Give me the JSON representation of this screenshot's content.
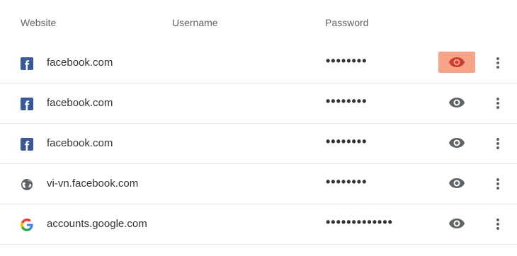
{
  "columns": {
    "website": "Website",
    "username": "Username",
    "password": "Password"
  },
  "rows": [
    {
      "site": "facebook.com",
      "username": "",
      "password_mask": "••••••••",
      "site_icon": "facebook-icon",
      "eye_highlighted": true
    },
    {
      "site": "facebook.com",
      "username": "",
      "password_mask": "••••••••",
      "site_icon": "facebook-icon",
      "eye_highlighted": false
    },
    {
      "site": "facebook.com",
      "username": "",
      "password_mask": "••••••••",
      "site_icon": "facebook-icon",
      "eye_highlighted": false
    },
    {
      "site": "vi-vn.facebook.com",
      "username": "",
      "password_mask": "••••••••",
      "site_icon": "globe-icon",
      "eye_highlighted": false
    },
    {
      "site": "accounts.google.com",
      "username": "",
      "password_mask": "•••••••••••••",
      "site_icon": "google-icon",
      "eye_highlighted": false
    }
  ],
  "colors": {
    "facebook": "#3b5998",
    "eye": "#5f6368",
    "eye_highlight": "#f7a48b",
    "eye_active": "#cc3d2b",
    "separator": "#e6e6e6",
    "header_text": "#5f6368",
    "body_text": "#333333"
  }
}
